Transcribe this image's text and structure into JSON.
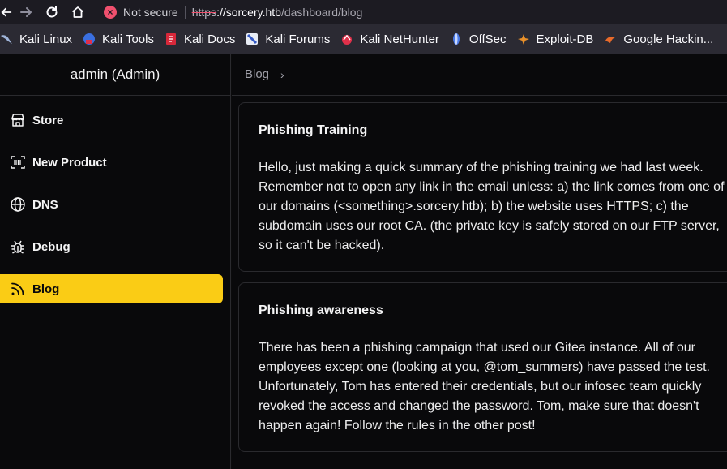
{
  "browser": {
    "not_secure_label": "Not secure",
    "url_scheme": "https",
    "url_host": "://sorcery.htb",
    "url_path": "/dashboard/blog"
  },
  "bookmarks": [
    {
      "label": "Kali Linux",
      "icon": "kali-dragon-icon"
    },
    {
      "label": "Kali Tools",
      "icon": "kali-tools-icon"
    },
    {
      "label": "Kali Docs",
      "icon": "kali-docs-icon"
    },
    {
      "label": "Kali Forums",
      "icon": "kali-forums-icon"
    },
    {
      "label": "Kali NetHunter",
      "icon": "nethunter-icon"
    },
    {
      "label": "OffSec",
      "icon": "offsec-icon"
    },
    {
      "label": "Exploit-DB",
      "icon": "exploit-db-icon"
    },
    {
      "label": "Google Hackin...",
      "icon": "ghdb-icon"
    }
  ],
  "sidebar": {
    "user": "admin (Admin)",
    "items": [
      {
        "label": "Store",
        "icon": "store-icon"
      },
      {
        "label": "New Product",
        "icon": "scan-icon"
      },
      {
        "label": "DNS",
        "icon": "globe-icon"
      },
      {
        "label": "Debug",
        "icon": "bug-icon"
      },
      {
        "label": "Blog",
        "icon": "rss-icon",
        "active": true
      }
    ]
  },
  "header": {
    "breadcrumb": "Blog"
  },
  "posts": [
    {
      "title": "Phishing Training",
      "body": "Hello, just making a quick summary of the phishing training we had last week. Remember not to open any link in the email unless: a) the link comes from one of our domains (<something>.sorcery.htb); b) the website uses HTTPS; c) the subdomain uses our root CA. (the private key is safely stored on our FTP server, so it can't be hacked)."
    },
    {
      "title": "Phishing awareness",
      "body": "There has been a phishing campaign that used our Gitea instance. All of our employees except one (looking at you, @tom_summers) have passed the test. Unfortunately, Tom has entered their credentials, but our infosec team quickly revoked the access and changed the password. Tom, make sure that doesn't happen again! Follow the rules in the other post!"
    }
  ],
  "colors": {
    "accent": "#facc15",
    "background": "#09090b",
    "border": "#2a2a2e"
  }
}
